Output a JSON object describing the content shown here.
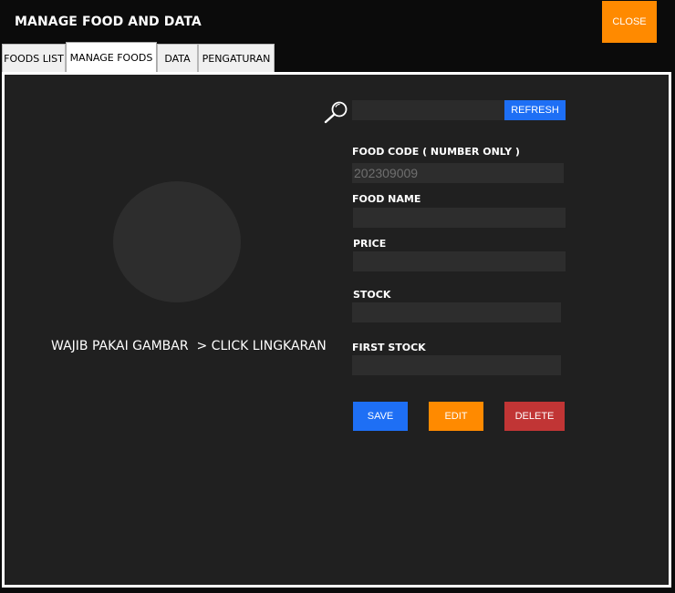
{
  "window": {
    "title": "MANAGE FOOD AND DATA",
    "close_label": "CLOSE"
  },
  "tabs": [
    {
      "label": "FOODS LIST",
      "active": false
    },
    {
      "label": "MANAGE FOODS",
      "active": true
    },
    {
      "label": "DATA",
      "active": false
    },
    {
      "label": "PENGATURAN",
      "active": false
    }
  ],
  "image_area": {
    "hint": "WAJIB PAKAI GAMBAR  > CLICK LINGKARAN"
  },
  "search": {
    "value": "",
    "refresh_label": "REFRESH"
  },
  "form": {
    "food_code_label": "FOOD CODE ( NUMBER ONLY )",
    "food_code_value": "202309009",
    "food_name_label": "FOOD NAME",
    "food_name_value": "",
    "price_label": "PRICE",
    "price_value": "",
    "stock_label": "STOCK",
    "stock_value": "",
    "first_stock_label": "FIRST STOCK",
    "first_stock_value": ""
  },
  "actions": {
    "save_label": "SAVE",
    "edit_label": "EDIT",
    "delete_label": "DELETE"
  },
  "colors": {
    "accent_blue": "#1e6ff5",
    "accent_orange": "#ff8a00",
    "danger_red": "#c13535",
    "background": "#202020"
  }
}
